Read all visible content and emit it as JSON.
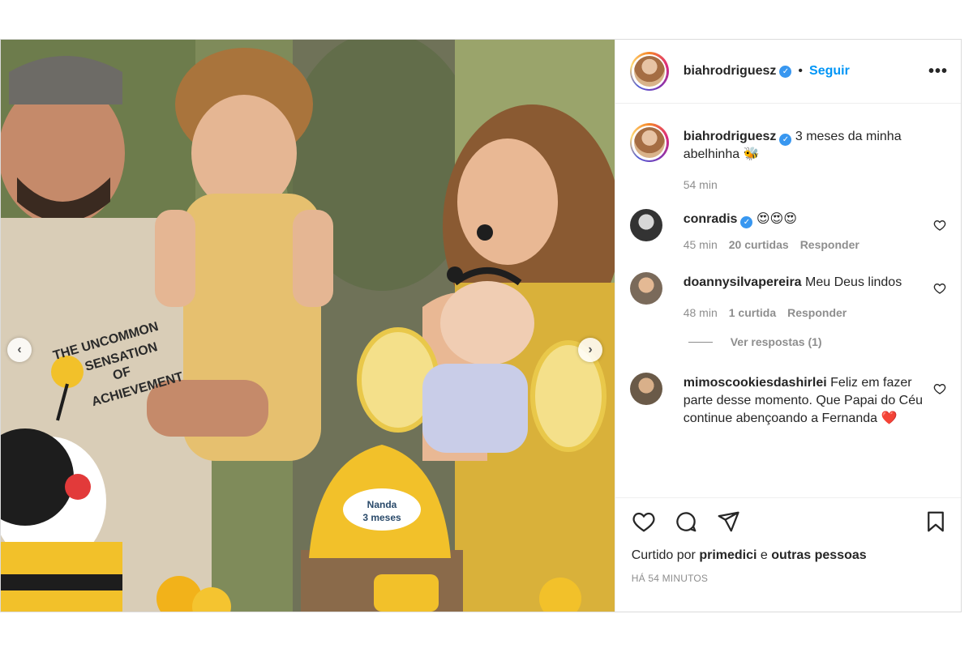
{
  "post": {
    "author": "biahrodriguesz",
    "follow_label": "Seguir",
    "more_label": "•••",
    "dot": "•"
  },
  "caption": {
    "username": "biahrodriguesz",
    "text": "3 meses da minha abelhinha 🐝",
    "time": "54 min"
  },
  "comments": [
    {
      "username": "conradis",
      "verified": true,
      "text": "😍😍😍",
      "time": "45 min",
      "likes": "20 curtidas",
      "reply": "Responder"
    },
    {
      "username": "doannysilvapereira",
      "verified": false,
      "text": "Meu Deus lindos",
      "time": "48 min",
      "likes": "1 curtida",
      "reply": "Responder"
    },
    {
      "username": "mimoscookiesdashirlei",
      "verified": false,
      "text": "Feliz em fazer parte desse momento. Que Papai do Céu continue abençoando a Fernanda ❤️",
      "time": "",
      "likes": "",
      "reply": ""
    }
  ],
  "view_replies": "Ver respostas (1)",
  "likes_line": {
    "prefix": "Curtido por",
    "user": "primedici",
    "mid": "e",
    "others": "outras pessoas"
  },
  "posted_time": "HÁ 54 MINUTOS",
  "photo": {
    "shirt_text": [
      "THE UNCOMMON",
      "SENSATION",
      "OF",
      "ACHIEVEMENT"
    ],
    "cake_label": [
      "Nanda",
      "3 meses"
    ]
  },
  "colors": {
    "accent": "#0095f6",
    "verified": "#3897f0",
    "muted": "#8e8e8e"
  }
}
